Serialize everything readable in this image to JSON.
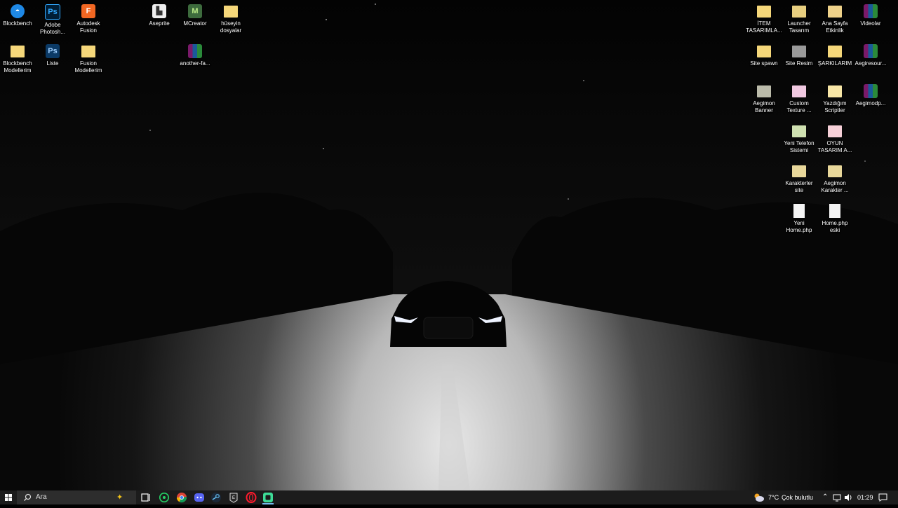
{
  "desktop": {
    "icons_left": [
      {
        "label": "Blockbench",
        "icon": "blockbench-icon"
      },
      {
        "label": "Adobe\nPhotosh...",
        "icon": "photoshop-icon"
      },
      {
        "label": "Autodesk\nFusion",
        "icon": "fusion-icon"
      },
      {
        "label": "Aseprite",
        "icon": "aseprite-icon"
      },
      {
        "label": "MCreator",
        "icon": "mcreator-icon"
      },
      {
        "label": "hüseyin\ndosyalar",
        "icon": "folder-icon"
      },
      {
        "label": "Blockbench\nModellerim",
        "icon": "folder-icon"
      },
      {
        "label": "Liste",
        "icon": "psd-file-icon"
      },
      {
        "label": "Fusion\nModellerim",
        "icon": "folder-icon"
      },
      {
        "label": "another-fa...",
        "icon": "winrar-icon"
      }
    ],
    "icons_right": [
      {
        "label": "İTEM\nTASARIMLA...",
        "icon": "folder-icon"
      },
      {
        "label": "Launcher\nTasarım",
        "icon": "folder-icon"
      },
      {
        "label": "Ana Sayfa\nEtkinlik",
        "icon": "folder-icon"
      },
      {
        "label": "Videolar",
        "icon": "winrar-icon"
      },
      {
        "label": "Site spawn",
        "icon": "folder-icon"
      },
      {
        "label": "Site Resim",
        "icon": "folder-icon"
      },
      {
        "label": "ŞARKILARIM",
        "icon": "folder-icon"
      },
      {
        "label": "Aegiresour...",
        "icon": "winrar-icon"
      },
      {
        "label": "Aegimon\nBanner",
        "icon": "folder-icon"
      },
      {
        "label": "Custom\nTexture ...",
        "icon": "folder-icon"
      },
      {
        "label": "Yazdığım\nScriptler",
        "icon": "folder-icon"
      },
      {
        "label": "Aegimodp...",
        "icon": "winrar-icon"
      },
      {
        "label": "Yeni Telefon\nSistemi",
        "icon": "folder-icon"
      },
      {
        "label": "OYUN\nTASARIM A...",
        "icon": "folder-icon"
      },
      {
        "label": "Karakterler\nsite",
        "icon": "folder-icon"
      },
      {
        "label": "Aegimon\nKarakter ...",
        "icon": "folder-icon"
      },
      {
        "label": "Yeni\nHome.php",
        "icon": "file-icon"
      },
      {
        "label": "Home.php\neski",
        "icon": "file-icon"
      }
    ]
  },
  "taskbar": {
    "search_placeholder": "Ara",
    "apps": [
      "task-view-icon",
      "whatsapp-icon",
      "chrome-icon",
      "discord-icon",
      "steam-icon",
      "epic-games-icon",
      "opera-icon",
      "app-icon"
    ],
    "weather_temp": "7°C",
    "weather_desc": "Çok bulutlu",
    "clock": "01:29"
  },
  "colors": {
    "taskbar_bg": "#1c1c1c",
    "search_bg": "#2d2d2d",
    "folder": "#f5d77a",
    "accent": "#76b9ed"
  }
}
